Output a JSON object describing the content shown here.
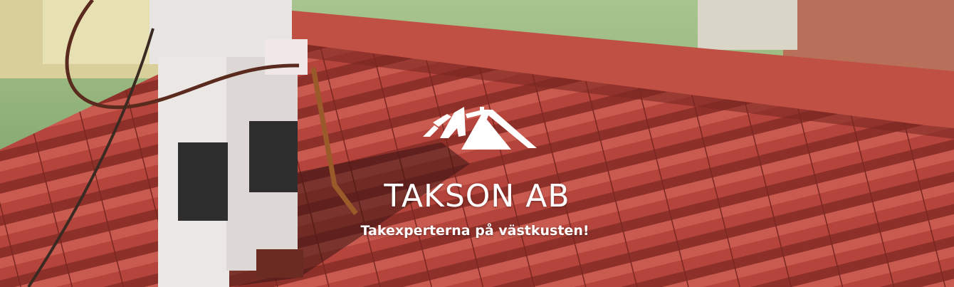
{
  "brand": {
    "name": "TAKSON AB",
    "tagline": "Takexperterna på västkusten!"
  },
  "icons": {
    "logo": "house-roof-icon"
  },
  "colors": {
    "roof_tile": "#b8473d",
    "roof_shadow": "#7e2823",
    "text": "#ffffff",
    "foliage": "#7fa866"
  }
}
